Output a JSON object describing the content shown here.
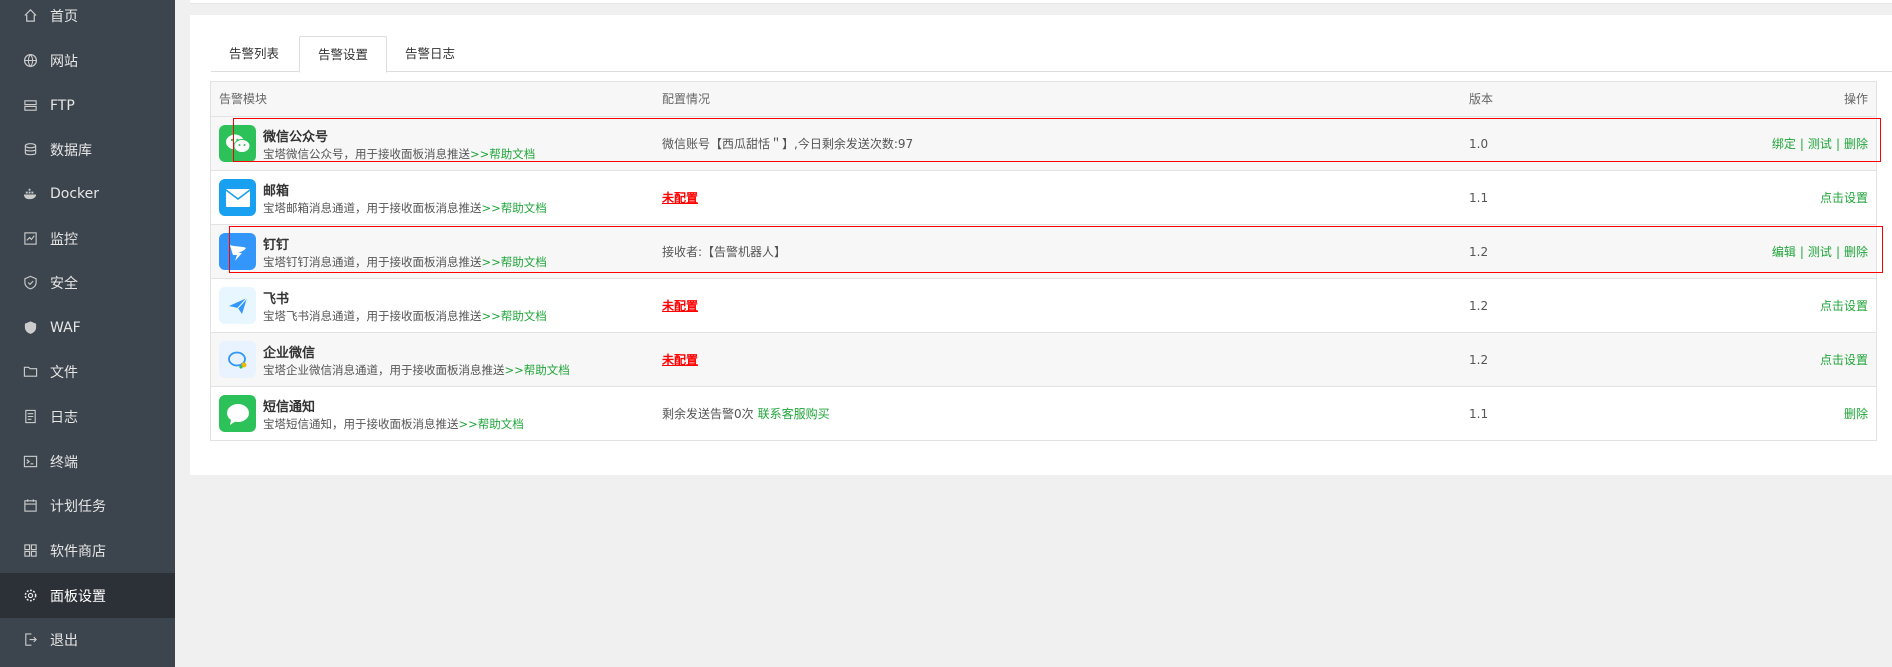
{
  "sidebar": {
    "items": [
      {
        "label": "首页",
        "icon": "home-icon"
      },
      {
        "label": "网站",
        "icon": "globe-icon"
      },
      {
        "label": "FTP",
        "icon": "ftp-icon"
      },
      {
        "label": "数据库",
        "icon": "database-icon"
      },
      {
        "label": "Docker",
        "icon": "docker-icon"
      },
      {
        "label": "监控",
        "icon": "monitor-icon"
      },
      {
        "label": "安全",
        "icon": "shield-icon"
      },
      {
        "label": "WAF",
        "icon": "waf-shield-icon"
      },
      {
        "label": "文件",
        "icon": "folder-icon"
      },
      {
        "label": "日志",
        "icon": "log-icon"
      },
      {
        "label": "终端",
        "icon": "terminal-icon"
      },
      {
        "label": "计划任务",
        "icon": "calendar-icon"
      },
      {
        "label": "软件商店",
        "icon": "grid-icon"
      },
      {
        "label": "面板设置",
        "icon": "gear-icon"
      },
      {
        "label": "退出",
        "icon": "logout-icon"
      }
    ],
    "active_index": 13
  },
  "tabs": [
    {
      "label": "告警列表"
    },
    {
      "label": "告警设置"
    },
    {
      "label": "告警日志"
    }
  ],
  "active_tab": 1,
  "table": {
    "headers": {
      "module": "告警模块",
      "config": "配置情况",
      "version": "版本",
      "ops": "操作"
    },
    "rows": [
      {
        "name": "微信公众号",
        "desc": "宝塔微信公众号，用于接收面板消息推送",
        "help": ">>帮助文档",
        "config_text": "微信账号【西瓜甜恬＂】,今日剩余发送次数:97",
        "version": "1.0",
        "ops": [
          "绑定",
          "测试",
          "删除"
        ],
        "logo": "wechat-icon",
        "color": "#2dc15a"
      },
      {
        "name": "邮箱",
        "desc": "宝塔邮箱消息通道，用于接收面板消息推送",
        "help": ">>帮助文档",
        "config_unset": "未配置",
        "version": "1.1",
        "ops": [
          "点击设置"
        ],
        "logo": "mail-icon",
        "color": "#1aa0f0"
      },
      {
        "name": "钉钉",
        "desc": "宝塔钉钉消息通道，用于接收面板消息推送",
        "help": ">>帮助文档",
        "config_text": "接收者:【告警机器人】",
        "version": "1.2",
        "ops": [
          "编辑",
          "测试",
          "删除"
        ],
        "logo": "dingtalk-icon",
        "color": "#3296fa"
      },
      {
        "name": "飞书",
        "desc": "宝塔飞书消息通道，用于接收面板消息推送",
        "help": ">>帮助文档",
        "config_unset": "未配置",
        "version": "1.2",
        "ops": [
          "点击设置"
        ],
        "logo": "feishu-icon",
        "color": "#e8f6ff"
      },
      {
        "name": "企业微信",
        "desc": "宝塔企业微信消息通道，用于接收面板消息推送",
        "help": ">>帮助文档",
        "config_unset": "未配置",
        "version": "1.2",
        "ops": [
          "点击设置"
        ],
        "logo": "wecom-icon",
        "color": "#e8f3ff"
      },
      {
        "name": "短信通知",
        "desc": "宝塔短信通知，用于接收面板消息推送",
        "help": ">>帮助文档",
        "config_text": "剩余发送告警0次",
        "config_link": "联系客服购买",
        "version": "1.1",
        "ops": [
          "删除"
        ],
        "logo": "sms-icon",
        "color": "#2dc15a"
      }
    ]
  },
  "colors": {
    "sidebar_bg": "#3c444d",
    "sidebar_active_bg": "#2c3138",
    "accent_green": "#20a53a",
    "unset_red": "#ff0000",
    "highlight_red": "#ff0000"
  }
}
